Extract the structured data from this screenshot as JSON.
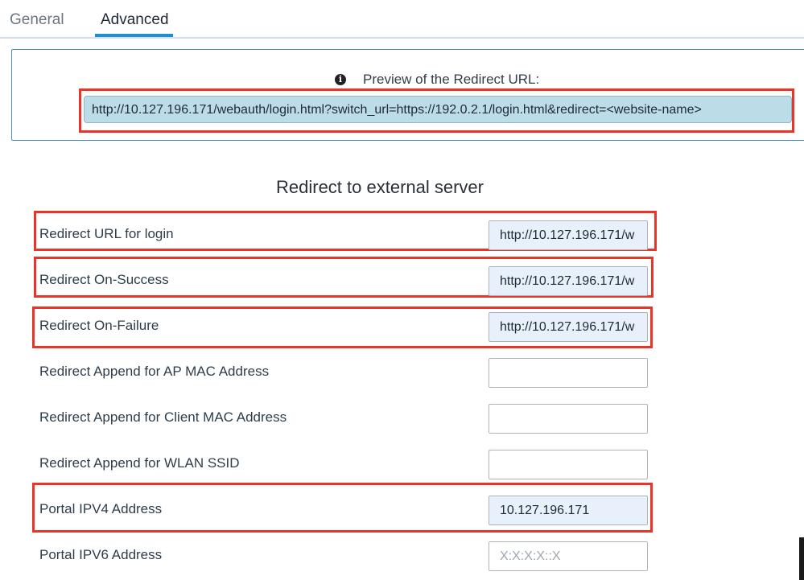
{
  "tabs": [
    {
      "label": "General",
      "active": false
    },
    {
      "label": "Advanced",
      "active": true
    }
  ],
  "preview": {
    "label": "Preview of the Redirect URL:",
    "url": "http://10.127.196.171/webauth/login.html?switch_url=https://192.0.2.1/login.html&redirect=<website-name>"
  },
  "section": {
    "title": "Redirect to external server"
  },
  "rows": [
    {
      "label": "Redirect URL for login",
      "value": "http://10.127.196.171/w",
      "placeholder": ""
    },
    {
      "label": "Redirect On-Success",
      "value": "http://10.127.196.171/w",
      "placeholder": ""
    },
    {
      "label": "Redirect On-Failure",
      "value": "http://10.127.196.171/w",
      "placeholder": ""
    },
    {
      "label": "Redirect Append for AP MAC Address",
      "value": "",
      "placeholder": ""
    },
    {
      "label": "Redirect Append for Client MAC Address",
      "value": "",
      "placeholder": ""
    },
    {
      "label": "Redirect Append for WLAN SSID",
      "value": "",
      "placeholder": ""
    },
    {
      "label": "Portal IPV4 Address",
      "value": "10.127.196.171",
      "placeholder": ""
    },
    {
      "label": "Portal IPV6 Address",
      "value": "",
      "placeholder": "X:X:X:X::X"
    }
  ],
  "colors": {
    "accent": "#1c8fd0",
    "highlight": "#e8352a",
    "preview_bg": "#bcdde8",
    "filled_field_bg": "#e8f0fb"
  },
  "icons": {
    "info": "info-circle-icon"
  }
}
